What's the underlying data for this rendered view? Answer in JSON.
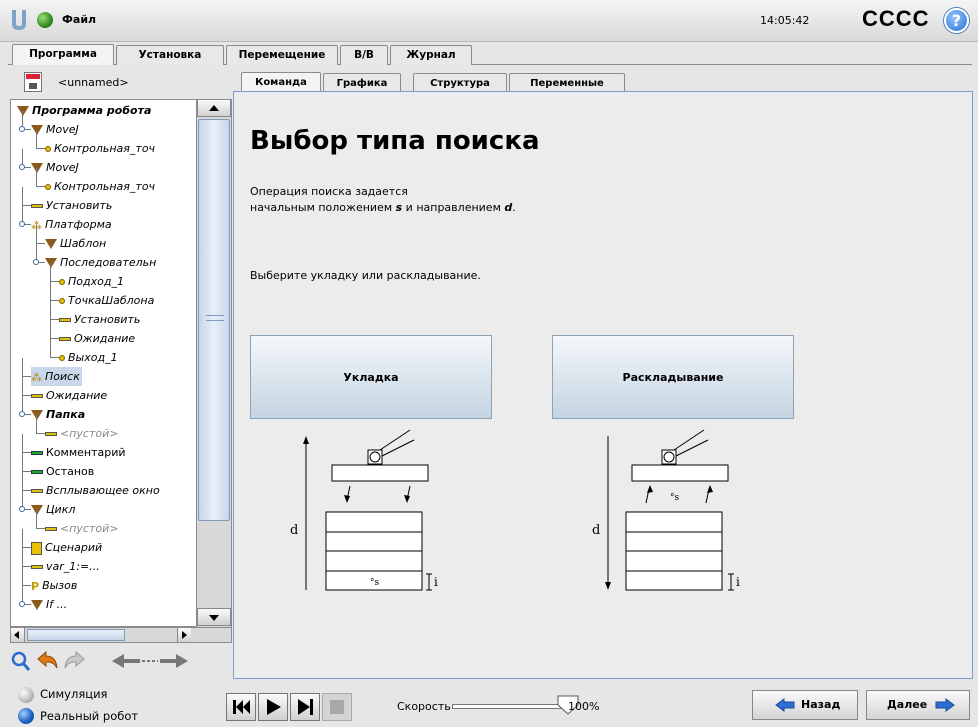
{
  "topbar": {
    "file_label": "Файл",
    "time": "14:05:42",
    "robot_name": "CCCC",
    "help_symbol": "?"
  },
  "main_tabs": [
    "Программа",
    "Установка",
    "Перемещение",
    "В/В",
    "Журнал"
  ],
  "program_name": "<unnamed>",
  "sub_tabs": [
    "Команда",
    "Графика",
    "Структура",
    "Переменные"
  ],
  "tree": [
    {
      "label": "Программа робота",
      "level": 0,
      "icon": "triangle",
      "bold": true
    },
    {
      "label": "MoveJ",
      "level": 1,
      "icon": "triangle"
    },
    {
      "label": "Контрольная_точ",
      "level": 2,
      "icon": "waypoint"
    },
    {
      "label": "MoveJ",
      "level": 1,
      "icon": "triangle"
    },
    {
      "label": "Контрольная_точ",
      "level": 2,
      "icon": "waypoint"
    },
    {
      "label": "Установить",
      "level": 1,
      "icon": "bar"
    },
    {
      "label": "Платформа",
      "level": 1,
      "icon": "pallet"
    },
    {
      "label": "Шаблон",
      "level": 2,
      "icon": "triangle"
    },
    {
      "label": "Последовательн",
      "level": 2,
      "icon": "triangle"
    },
    {
      "label": "Подход_1",
      "level": 3,
      "icon": "waypoint"
    },
    {
      "label": "ТочкаШаблона",
      "level": 3,
      "icon": "waypoint"
    },
    {
      "label": "Установить",
      "level": 3,
      "icon": "bar"
    },
    {
      "label": "Ожидание",
      "level": 3,
      "icon": "bar"
    },
    {
      "label": "Выход_1",
      "level": 3,
      "icon": "waypoint"
    },
    {
      "label": "Поиск",
      "level": 1,
      "icon": "pallet",
      "selected": true
    },
    {
      "label": "Ожидание",
      "level": 1,
      "icon": "bar"
    },
    {
      "label": "Папка",
      "level": 1,
      "icon": "triangle",
      "bold": true
    },
    {
      "label": "<пустой>",
      "level": 2,
      "icon": "bar",
      "grey": true
    },
    {
      "label": "Комментарий",
      "level": 1,
      "icon": "green",
      "upright": true
    },
    {
      "label": "Останов",
      "level": 1,
      "icon": "green",
      "upright": true
    },
    {
      "label": "Всплывающее окно",
      "level": 1,
      "icon": "bar"
    },
    {
      "label": "Цикл",
      "level": 1,
      "icon": "triangle"
    },
    {
      "label": "<пустой>",
      "level": 2,
      "icon": "bar",
      "grey": true
    },
    {
      "label": "Сценарий",
      "level": 1,
      "icon": "script"
    },
    {
      "label": "var_1:=...",
      "level": 1,
      "icon": "bar"
    },
    {
      "label": "Вызов",
      "level": 1,
      "icon": "call"
    },
    {
      "label": "If ...",
      "level": 1,
      "icon": "triangle"
    }
  ],
  "content": {
    "title": "Выбор типа поиска",
    "desc_line1": "Операция поиска задается",
    "desc_line2_pre": "начальным положением ",
    "desc_s": "s",
    "desc_mid": " и направлением ",
    "desc_d": "d",
    "desc_end": ".",
    "instruction": "Выберите укладку или раскладывание.",
    "stack_button": "Укладка",
    "destack_button": "Раскладывание",
    "diag_d": "d",
    "diag_s": "°s",
    "diag_i": "i"
  },
  "bottom": {
    "simulation": "Симуляция",
    "real_robot": "Реальный робот",
    "speed_label": "Скорость",
    "speed_value": "100%",
    "speed_fraction": 1.0,
    "back": "Назад",
    "next": "Далее"
  }
}
